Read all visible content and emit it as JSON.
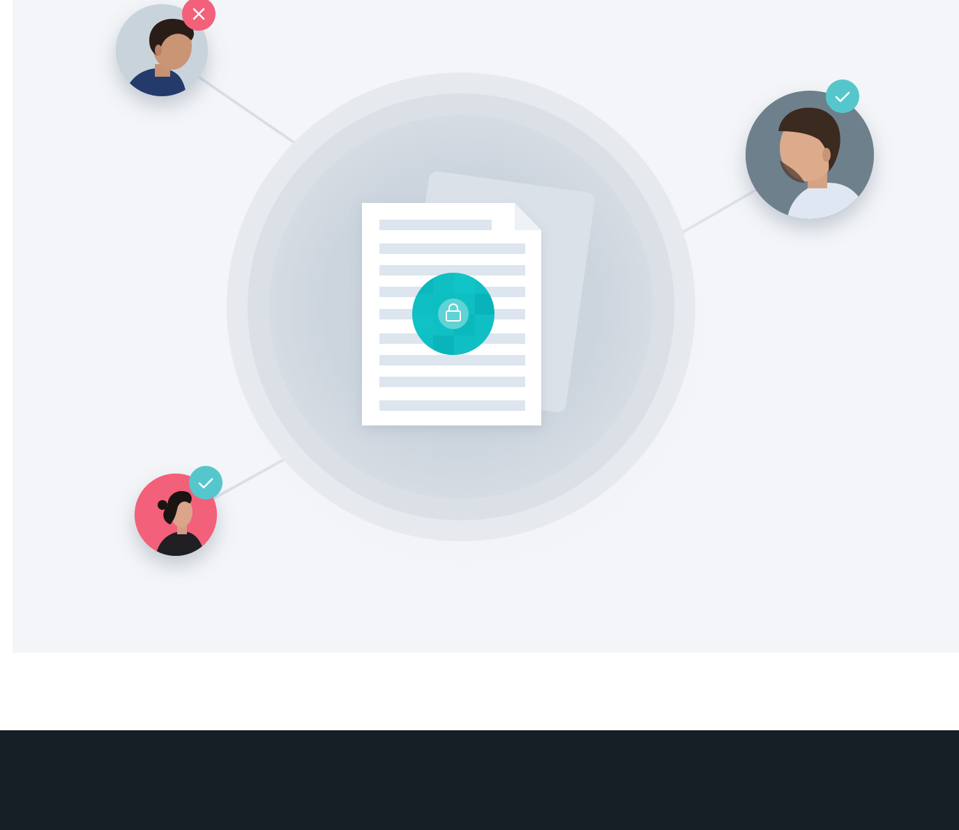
{
  "illustration": {
    "description_hidden": "",
    "colors": {
      "background": "#f3f5f8",
      "footer": "#171f26",
      "accent_teal": "#0fbfc4",
      "status_approved": "#55c7cc",
      "status_rejected": "#f2607a",
      "document": "#ffffff",
      "document_lines": "#dde5ee"
    },
    "center_icon": "lock-icon",
    "participants": [
      {
        "id": "participant-top-left",
        "status": "rejected",
        "status_icon": "close-icon"
      },
      {
        "id": "participant-right",
        "status": "approved",
        "status_icon": "check-icon"
      },
      {
        "id": "participant-bottom-left",
        "status": "approved",
        "status_icon": "check-icon"
      }
    ]
  }
}
